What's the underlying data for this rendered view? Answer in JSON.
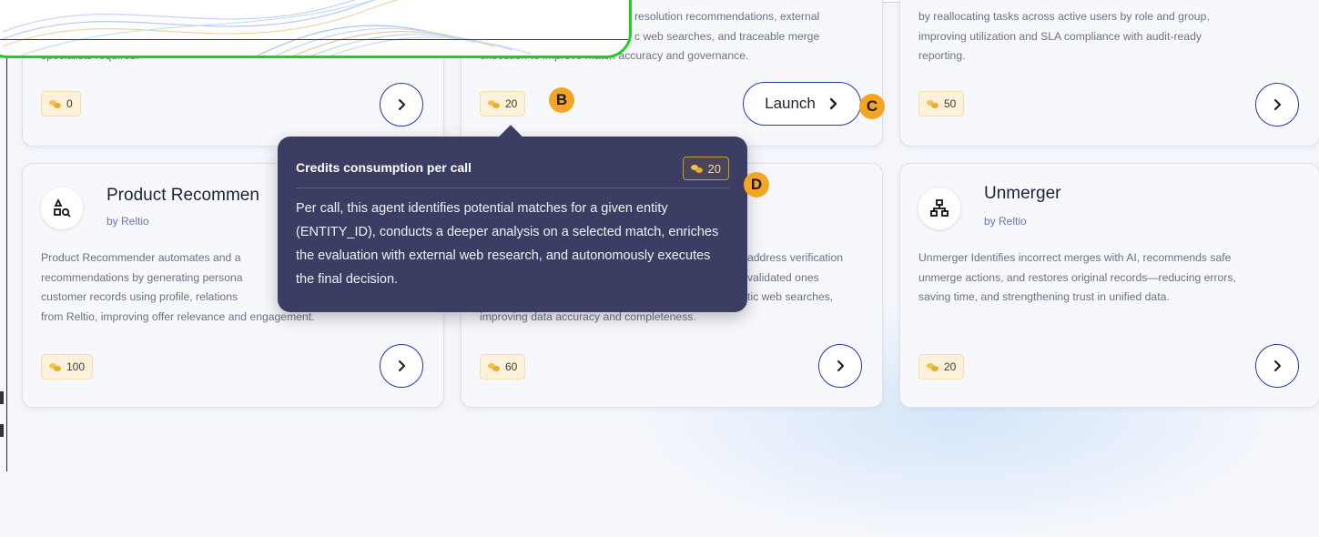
{
  "cards_row1": [
    {
      "id": "card-1",
      "desc_lines": [
        "specialists required."
      ],
      "credits": "0"
    },
    {
      "id": "card-2",
      "desc_lines": [
        "resolution recommendations, external",
        "c web searches, and traceable merge",
        "execution to improve match accuracy and governance."
      ],
      "credits": "20",
      "badge": "B"
    },
    {
      "id": "card-3",
      "desc_lines": [
        "by reallocating tasks across active users by role and group,",
        "improving utilization and SLA compliance with audit-ready",
        "reporting."
      ],
      "credits": "50"
    }
  ],
  "launch_button": {
    "label": "Launch",
    "badge": "C"
  },
  "cards_row2": [
    {
      "id": "product-recommender",
      "title": "Product Recommen",
      "by": "by Reltio",
      "desc_lines": [
        "Product Recommender automates and a",
        "recommendations by generating persona",
        "customer records using profile, relations",
        "from Reltio, improving offer relevance and engagement."
      ],
      "credits": "100"
    },
    {
      "id": "card-5",
      "desc_lines": [
        "address verification",
        "validated ones",
        "tic web searches,",
        "improving data accuracy and completeness."
      ],
      "credits": "60"
    },
    {
      "id": "unmerger",
      "title": "Unmerger",
      "by": "by Reltio",
      "desc_lines": [
        "Unmerger Identifies incorrect merges with AI, recommends safe",
        "unmerge actions, and restores original records—reducing errors,",
        "saving time, and strengthening trust in unified data."
      ],
      "credits": "20"
    }
  ],
  "tooltip": {
    "title": "Credits consumption per call",
    "credits": "20",
    "badge": "D",
    "body": "Per call, this agent identifies potential matches for a given entity (ENTITY_ID), conducts a deeper analysis on a selected match, enriches the evaluation with external web research, and autonomously executes the final decision."
  },
  "icons": {
    "arrow": "chevron-right-icon",
    "credit": "coins-icon",
    "product": "product-search-icon",
    "unmerger": "hierarchy-icon"
  },
  "colors": {
    "accent": "#2b35a3",
    "badge": "#f5a524",
    "tooltip_bg": "#3b3d63",
    "credit_bg": "#fdf1da",
    "overlay": "#19d21e"
  }
}
